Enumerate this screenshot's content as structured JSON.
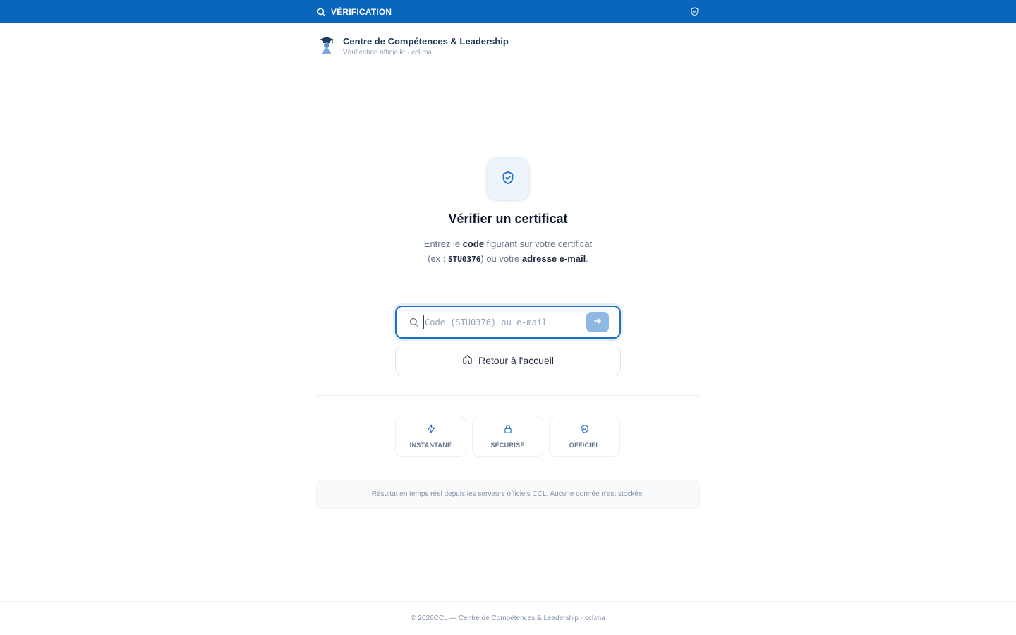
{
  "topbar": {
    "title": "VÉRIFICATION",
    "left_icon": "search-icon",
    "right_icon": "shield-check-icon",
    "bg_color": "#0a66bd"
  },
  "header": {
    "brand_name": "Centre de Compétences & Leadership",
    "brand_sub": "Vérification officielle · ccl.ma",
    "logo_icon": "graduate-logo-icon"
  },
  "main": {
    "badge_icon": "shield-check-icon",
    "title": "Vérifier un certificat",
    "desc": {
      "line1_pre": "Entrez le ",
      "line1_bold": "code",
      "line1_post": " figurant sur votre certificat",
      "line2_pre": "(ex : ",
      "line2_code": "STU0376",
      "line2_mid": ") ou votre ",
      "line2_bold": "adresse e-mail",
      "line2_post": "."
    },
    "search": {
      "placeholder": "Code (STU0376) ou e-mail",
      "value": "",
      "submit_icon": "arrow-right-icon"
    },
    "home_button": {
      "label": "Retour à l'accueil",
      "icon": "home-icon"
    },
    "features": [
      {
        "label": "INSTANTANÉ",
        "icon": "lightning-icon"
      },
      {
        "label": "SÉCURISÉ",
        "icon": "lock-icon"
      },
      {
        "label": "OFFICIEL",
        "icon": "shield-check-icon"
      }
    ],
    "notice": "Résultat en temps réel depuis les serveurs officiels CCL. Aucune donnée n'est stockée."
  },
  "footer": {
    "text": "© 2026CCL — Centre de Compétences & Leadership · ccl.ma"
  },
  "colors": {
    "accent": "#1f6fc5",
    "brand_dark": "#1e3a5f"
  }
}
